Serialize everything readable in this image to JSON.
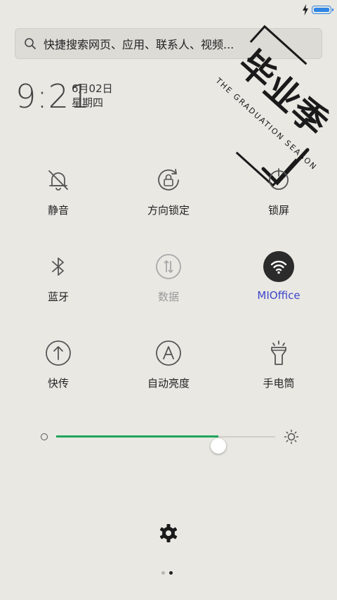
{
  "status": {
    "battery_level": 1.0,
    "charging": true,
    "battery_color": "#2f86e4"
  },
  "search": {
    "placeholder": "快捷搜索网页、应用、联系人、视频..."
  },
  "clock": {
    "time": "9:21",
    "date": "6月02日",
    "weekday": "星期四"
  },
  "stamp": {
    "title": "毕业季",
    "subtitle": "THE GRADUATION SEASON"
  },
  "tiles": [
    {
      "label": "静音",
      "icon": "bell-off-icon",
      "state": "on"
    },
    {
      "label": "方向锁定",
      "icon": "rotation-lock-icon",
      "state": "on"
    },
    {
      "label": "锁屏",
      "icon": "lock-screen-icon",
      "state": "on"
    },
    {
      "label": "蓝牙",
      "icon": "bluetooth-icon",
      "state": "on"
    },
    {
      "label": "数据",
      "icon": "mobile-data-icon",
      "state": "off"
    },
    {
      "label": "MIOffice",
      "icon": "wifi-icon",
      "state": "active"
    },
    {
      "label": "快传",
      "icon": "quick-transfer-icon",
      "state": "on"
    },
    {
      "label": "自动亮度",
      "icon": "auto-brightness-icon",
      "state": "on"
    },
    {
      "label": "手电筒",
      "icon": "flashlight-icon",
      "state": "on"
    }
  ],
  "brightness": {
    "level": 0.74,
    "accent_color": "#1fa55a"
  },
  "pager": {
    "pages": 2,
    "current": 2
  }
}
